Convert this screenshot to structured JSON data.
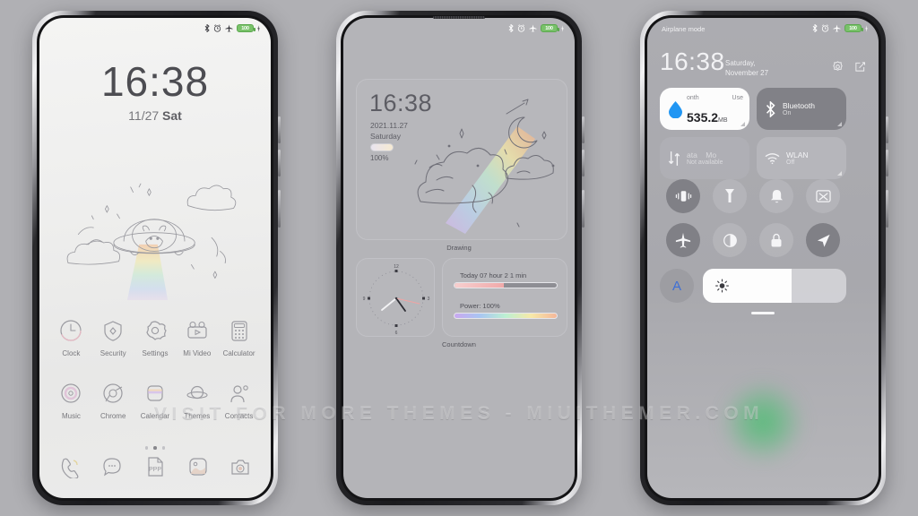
{
  "watermark": "VISIT FOR MORE THEMES - MIUITHEMER.COM",
  "background_color": "#b0b0b4",
  "status_bar": {
    "icons": [
      "bluetooth-icon",
      "alarm-icon",
      "airplane-icon",
      "battery-icon"
    ],
    "battery_level": "100"
  },
  "phone1": {
    "name": "Lock screen / Home screen",
    "clock": "16:38",
    "date_short": "11/27",
    "weekday_short": "Sat",
    "apps_row1": [
      {
        "label": "Clock",
        "icon": "clock-icon"
      },
      {
        "label": "Security",
        "icon": "shield-icon"
      },
      {
        "label": "Settings",
        "icon": "gear-icon"
      },
      {
        "label": "Mi Video",
        "icon": "video-icon"
      },
      {
        "label": "Calculator",
        "icon": "calculator-icon"
      }
    ],
    "apps_row2": [
      {
        "label": "Music",
        "icon": "disc-icon"
      },
      {
        "label": "Chrome",
        "icon": "chrome-icon"
      },
      {
        "label": "Calendar",
        "icon": "calendar-icon"
      },
      {
        "label": "Themes",
        "icon": "planet-icon"
      },
      {
        "label": "Contacts",
        "icon": "contacts-icon"
      }
    ],
    "page_dots": 3,
    "active_dot": 2,
    "dock": [
      {
        "label": "Phone",
        "icon": "phone-icon"
      },
      {
        "label": "Messages",
        "icon": "message-icon"
      },
      {
        "label": "Notes",
        "icon": "notes-icon"
      },
      {
        "label": "Gallery",
        "icon": "gallery-icon"
      },
      {
        "label": "Camera",
        "icon": "camera-icon"
      }
    ]
  },
  "phone2": {
    "name": "Widgets screen",
    "drawing_widget": {
      "time": "16:38",
      "date": "2021.11.27",
      "weekday": "Saturday",
      "battery_percent": "100%",
      "label": "Drawing"
    },
    "clock_widget": {
      "numerals": [
        "12",
        "3",
        "6",
        "9"
      ]
    },
    "countdown_widget": {
      "today_line": "Today 07 hour 2 1 min",
      "today_progress": 48,
      "power_line": "Power: 100%",
      "power_progress": 100,
      "label": "Countdown"
    }
  },
  "phone3": {
    "name": "Control center",
    "airplane_label": "Airplane mode",
    "clock": "16:38",
    "date": "Saturday, November 27",
    "header_icons": [
      "gear-icon",
      "edit-icon"
    ],
    "tiles": [
      {
        "title": "",
        "sub": "",
        "icon": "data-drop-icon",
        "state": "on-white",
        "head_left": "onth",
        "head_right": "Use",
        "value": "535.2",
        "unit": "MB"
      },
      {
        "title": "Bluetooth",
        "sub": "On",
        "icon": "bluetooth-icon",
        "state": "on-dark"
      },
      {
        "title": "ata",
        "sub": "Not available",
        "icon": "mobile-data-icon",
        "state": "dim",
        "title2": "Mo"
      },
      {
        "title": "WLAN",
        "sub": "Off",
        "icon": "wifi-icon",
        "state": "off"
      }
    ],
    "toggles": [
      {
        "icon": "vibrate-icon",
        "active": true
      },
      {
        "icon": "flashlight-icon",
        "active": false
      },
      {
        "icon": "bell-icon",
        "active": false
      },
      {
        "icon": "screenshot-icon",
        "active": false
      },
      {
        "icon": "airplane-icon",
        "active": true
      },
      {
        "icon": "dark-mode-icon",
        "active": false
      },
      {
        "icon": "rotation-lock-icon",
        "active": false
      },
      {
        "icon": "location-icon",
        "active": true
      }
    ],
    "auto_brightness_label": "A",
    "brightness_percent": 62,
    "brightness_icon": "sun-icon"
  }
}
